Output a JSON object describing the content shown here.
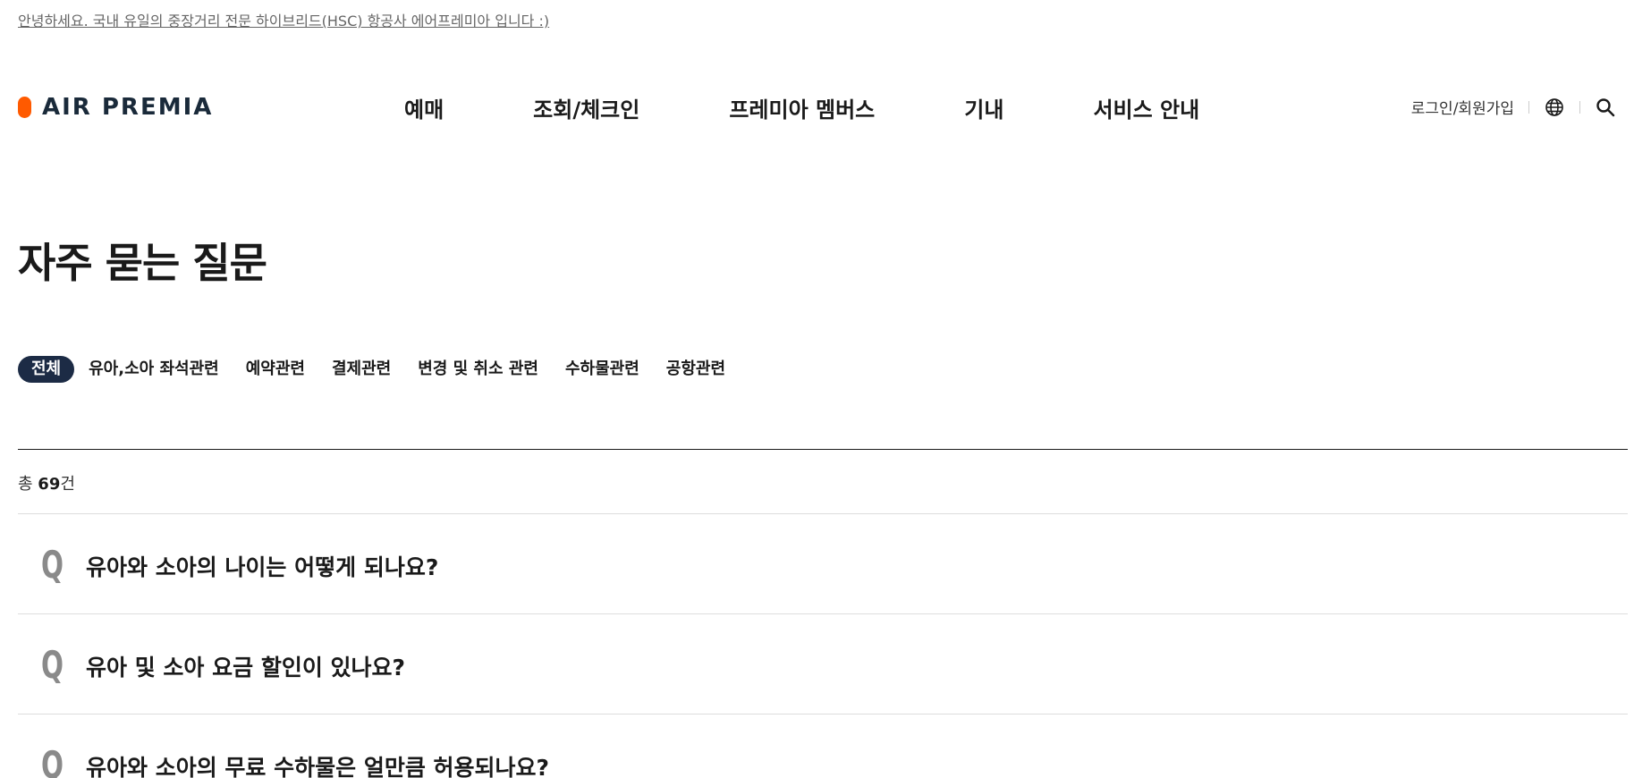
{
  "notice": {
    "text": "안녕하세요. 국내 유일의 중장거리 전문 하이브리드(HSC) 항공사 에어프레미아 입니다 :)"
  },
  "header": {
    "logo_text": "AIR PREMIA",
    "logo_color": "#ff5a00",
    "nav": [
      {
        "label": "예매"
      },
      {
        "label": "조회/체크인"
      },
      {
        "label": "프레미아 멤버스"
      },
      {
        "label": "기내"
      },
      {
        "label": "서비스 안내"
      }
    ],
    "util": {
      "login_label": "로그인/회원가입",
      "language_icon": "globe-icon",
      "search_icon": "search-icon"
    }
  },
  "main": {
    "title": "자주 묻는 질문",
    "tabs": [
      {
        "label": "전체",
        "active": true
      },
      {
        "label": "유아,소아 좌석관련"
      },
      {
        "label": "예약관련"
      },
      {
        "label": "결제관련"
      },
      {
        "label": "변경 및 취소 관련"
      },
      {
        "label": "수하물관련"
      },
      {
        "label": "공항관련"
      }
    ],
    "count": {
      "prefix": "총 ",
      "value": "69",
      "suffix": "건"
    },
    "faq_marker": "Q",
    "faqs": [
      {
        "question": "유아와 소아의 나이는 어떻게 되나요?"
      },
      {
        "question": "유아 및 소아 요금 할인이 있나요?"
      },
      {
        "question": "유아와 소아의 무료 수하물은 얼만큼 허용되나요?"
      }
    ]
  },
  "colors": {
    "accent_navy": "#1c2b45",
    "brand_orange": "#ff5a00"
  }
}
